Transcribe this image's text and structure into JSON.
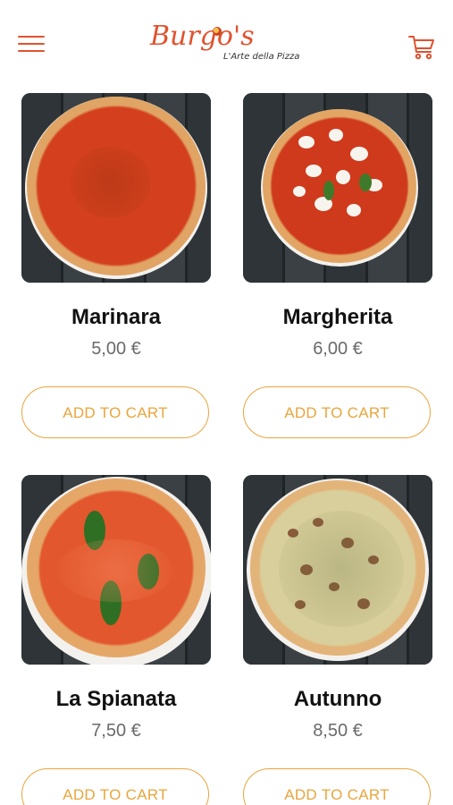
{
  "header": {
    "menu_icon": "hamburger-menu-icon",
    "logo_text": "Burgo's",
    "logo_tagline": "L'Arte della Pizza",
    "cart_icon": "cart-icon"
  },
  "colors": {
    "accent": "#e0522f",
    "button_border": "#e9a53c",
    "name_text": "#111111",
    "price_text": "#6a6a6a"
  },
  "products": [
    {
      "name": "Marinara",
      "price": "5,00 €",
      "button_label": "ADD TO CART"
    },
    {
      "name": "Margherita",
      "price": "6,00 €",
      "button_label": "ADD TO CART"
    },
    {
      "name": "La Spianata",
      "price": "7,50 €",
      "button_label": "ADD TO CART"
    },
    {
      "name": "Autunno",
      "price": "8,50 €",
      "button_label": "ADD TO CART"
    }
  ]
}
